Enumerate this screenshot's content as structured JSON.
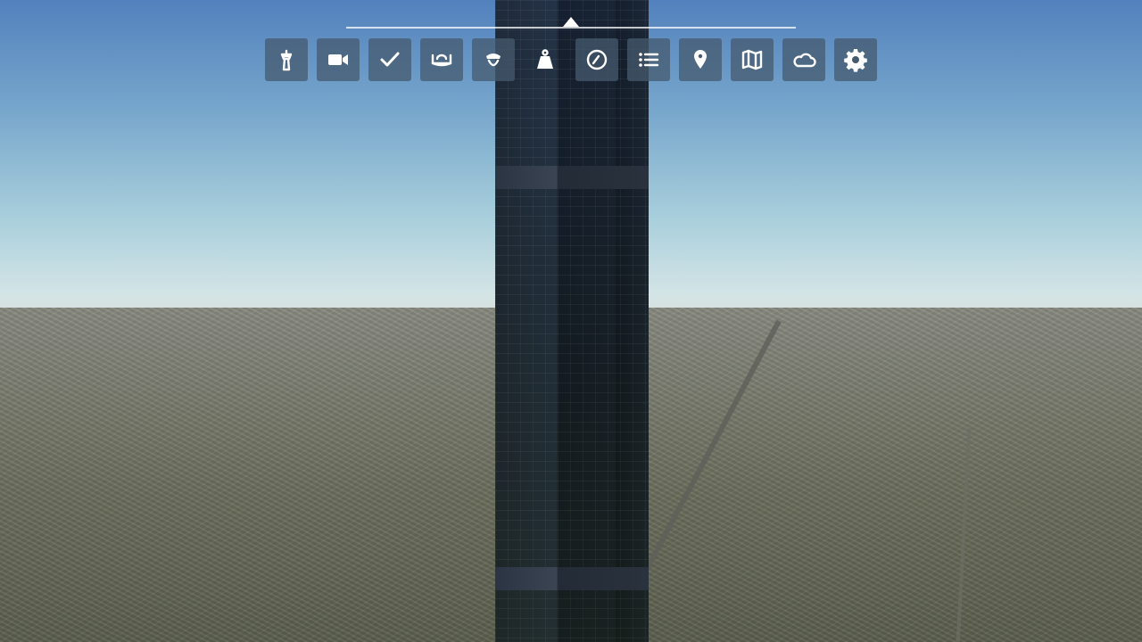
{
  "toolbar": {
    "selected_index": 5,
    "buttons": [
      {
        "id": "atc",
        "icon": "control-tower-icon"
      },
      {
        "id": "camera",
        "icon": "video-camera-icon"
      },
      {
        "id": "checklist",
        "icon": "checkmark-icon"
      },
      {
        "id": "controls",
        "icon": "yoke-icon"
      },
      {
        "id": "copilot",
        "icon": "pilot-cap-icon"
      },
      {
        "id": "weight-balance",
        "icon": "weight-icon"
      },
      {
        "id": "navlog",
        "icon": "compass-icon"
      },
      {
        "id": "objectives",
        "icon": "list-icon"
      },
      {
        "id": "travel-to",
        "icon": "map-pin-icon"
      },
      {
        "id": "vfr-map",
        "icon": "map-icon"
      },
      {
        "id": "weather",
        "icon": "cloud-icon"
      },
      {
        "id": "settings",
        "icon": "gear-icon"
      }
    ]
  }
}
